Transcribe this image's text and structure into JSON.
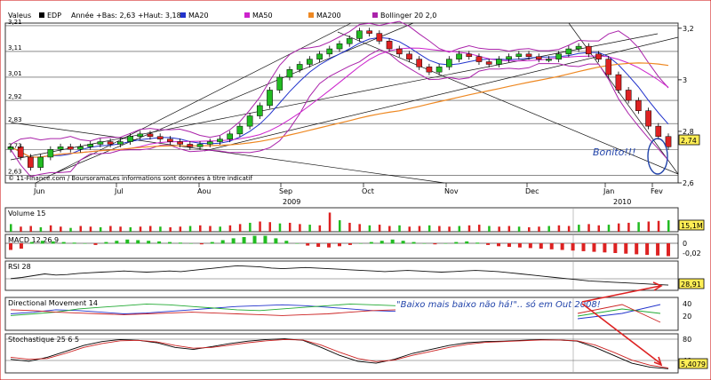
{
  "header": {
    "label_valeurs": "Valeus",
    "symbol": "EDP",
    "range_text": "Année +Bas: 2,63 +Haut: 3,18",
    "legend": [
      {
        "name": "MA20",
        "color": "#2233cc"
      },
      {
        "name": "MA50",
        "color": "#cc22cc"
      },
      {
        "name": "MA200",
        "color": "#ee8822"
      },
      {
        "name": "Bollinger 20 2,0",
        "color": "#aa22aa"
      }
    ]
  },
  "copyright": "© 11-Finance.com / BoursoramaLes informations sont données à titre indicatif",
  "x_axis": {
    "months": [
      "Jun",
      "Jul",
      "Aou",
      "Sep",
      "Oct",
      "Nov",
      "Dec",
      "Jan",
      "Fev"
    ],
    "years": [
      "2009",
      "2010"
    ]
  },
  "chart_data": [
    {
      "type": "candlestick",
      "title": "EDP",
      "ylim": [
        2.6,
        3.22
      ],
      "left_ticks": [
        "3,21",
        "3,11",
        "3,01",
        "2,92",
        "2,83",
        "2,73",
        "2,63"
      ],
      "right_ticks": [
        "3,2",
        "3",
        "2,8",
        "2,6"
      ],
      "last_value": "2,74",
      "close": [
        2.74,
        2.7,
        2.66,
        2.7,
        2.73,
        2.74,
        2.73,
        2.74,
        2.75,
        2.76,
        2.75,
        2.76,
        2.78,
        2.79,
        2.78,
        2.77,
        2.76,
        2.75,
        2.74,
        2.75,
        2.76,
        2.77,
        2.79,
        2.82,
        2.86,
        2.9,
        2.96,
        3.01,
        3.04,
        3.06,
        3.08,
        3.1,
        3.12,
        3.14,
        3.16,
        3.19,
        3.18,
        3.15,
        3.12,
        3.1,
        3.08,
        3.05,
        3.03,
        3.05,
        3.08,
        3.1,
        3.09,
        3.07,
        3.06,
        3.08,
        3.09,
        3.1,
        3.09,
        3.08,
        3.08,
        3.1,
        3.12,
        3.13,
        3.1,
        3.08,
        3.02,
        2.96,
        2.92,
        2.88,
        2.82,
        2.78,
        2.74
      ],
      "annotation_circle": "Bonito!!!"
    },
    {
      "type": "bar",
      "title": "Volume 15",
      "last_value": "15,1M",
      "values": [
        12,
        8,
        9,
        7,
        10,
        8,
        6,
        9,
        8,
        7,
        9,
        8,
        7,
        8,
        9,
        8,
        7,
        8,
        9,
        10,
        9,
        8,
        10,
        12,
        14,
        16,
        15,
        13,
        14,
        12,
        11,
        10,
        30,
        18,
        14,
        12,
        10,
        11,
        9,
        10,
        8,
        9,
        10,
        9,
        8,
        9,
        10,
        11,
        9,
        8,
        9,
        8,
        7,
        8,
        9,
        10,
        9,
        11,
        12,
        10,
        11,
        13,
        14,
        15,
        16,
        17,
        18
      ]
    },
    {
      "type": "bar",
      "title": "MACD 12 26 9",
      "right_ticks": [
        "0",
        "-0,02"
      ],
      "values": [
        -0.01,
        -0.008,
        0.002,
        0.004,
        0.003,
        0.002,
        0.001,
        0.0,
        -0.002,
        0.002,
        0.004,
        0.006,
        0.005,
        0.004,
        0.003,
        0.002,
        0.001,
        0.0,
        -0.001,
        0.002,
        0.005,
        0.008,
        0.01,
        0.012,
        0.012,
        0.008,
        0.004,
        0.0,
        -0.003,
        -0.005,
        -0.006,
        -0.004,
        -0.002,
        0.0,
        0.002,
        0.004,
        0.006,
        0.004,
        0.002,
        0.0,
        -0.001,
        0.0,
        0.002,
        0.003,
        0.001,
        -0.002,
        -0.004,
        -0.005,
        -0.006,
        -0.007,
        -0.008,
        -0.009,
        -0.01,
        -0.011,
        -0.012,
        -0.013,
        -0.014,
        -0.015,
        -0.016,
        -0.017,
        -0.018,
        -0.019,
        -0.02
      ]
    },
    {
      "type": "line",
      "title": "RSI 28",
      "last_value": "28,91",
      "values": [
        40,
        42,
        45,
        48,
        46,
        47,
        49,
        50,
        51,
        52,
        53,
        52,
        51,
        52,
        53,
        52,
        54,
        56,
        58,
        60,
        62,
        61,
        60,
        58,
        57,
        58,
        59,
        58,
        57,
        56,
        55,
        54,
        53,
        52,
        53,
        54,
        53,
        52,
        51,
        52,
        53,
        54,
        53,
        52,
        50,
        48,
        46,
        44,
        42,
        40,
        38,
        36,
        35,
        34,
        33,
        32,
        31,
        30,
        28.91
      ]
    },
    {
      "type": "line",
      "title": "Directional Movement 14",
      "right_ticks": [
        "40",
        "20"
      ],
      "series": [
        {
          "color": "#2233cc",
          "values": [
            20,
            22,
            25,
            24,
            22,
            20,
            21,
            23,
            25,
            27,
            29,
            30,
            31,
            30,
            28,
            26,
            24,
            23
          ]
        },
        {
          "color": "#22aa33",
          "values": [
            18,
            20,
            22,
            26,
            28,
            30,
            32,
            31,
            29,
            27,
            25,
            24,
            26,
            28,
            30,
            32,
            31,
            30
          ]
        },
        {
          "color": "#cc2222",
          "values": [
            25,
            24,
            22,
            21,
            20,
            19,
            20,
            21,
            22,
            21,
            20,
            19,
            18,
            19,
            20,
            22,
            24,
            25
          ]
        }
      ],
      "annotation": "\"Baixo mais baixo não há!\".. só em Out 2008!"
    },
    {
      "type": "line",
      "title": "Stochastique 25 6 5",
      "right_ticks": [
        "80",
        "40"
      ],
      "last_value": "5,4079",
      "series": [
        {
          "color": "#000000",
          "values": [
            30,
            25,
            35,
            50,
            65,
            75,
            80,
            78,
            72,
            60,
            55,
            62,
            70,
            76,
            80,
            82,
            78,
            60,
            40,
            25,
            20,
            30,
            45,
            55,
            65,
            72,
            75,
            76,
            78,
            80,
            79,
            76,
            60,
            40,
            20,
            10,
            6
          ]
        },
        {
          "color": "#cc2222",
          "values": [
            35,
            30,
            32,
            45,
            60,
            70,
            77,
            78,
            74,
            65,
            58,
            60,
            66,
            72,
            77,
            80,
            79,
            66,
            48,
            32,
            24,
            28,
            40,
            50,
            60,
            68,
            73,
            75,
            77,
            79,
            79,
            77,
            66,
            48,
            28,
            15,
            8
          ]
        }
      ]
    }
  ]
}
